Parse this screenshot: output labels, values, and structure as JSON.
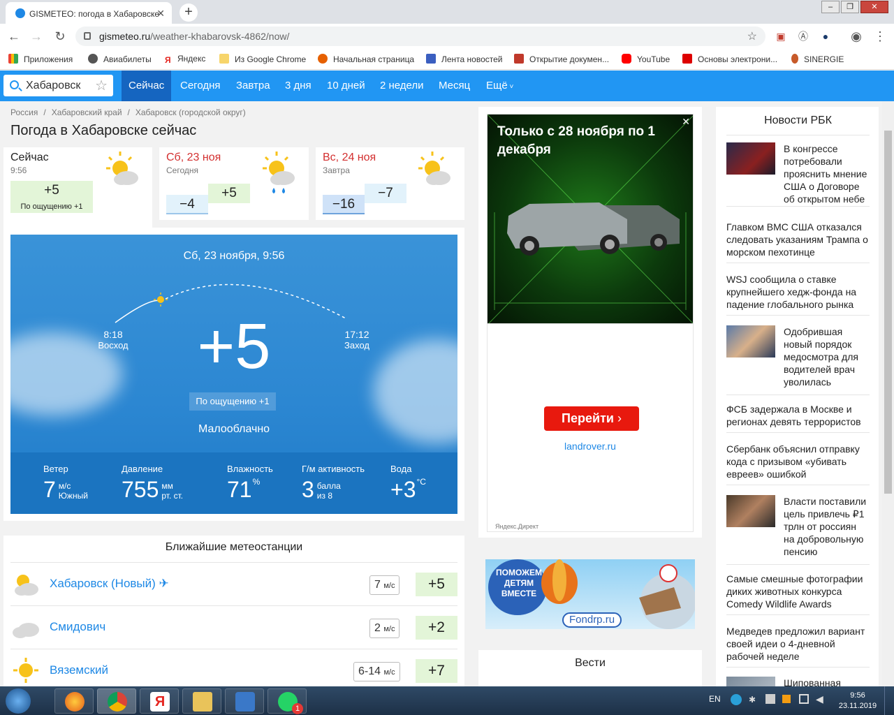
{
  "browser": {
    "tab_title": "GISMETEO: погода в Хабаровске",
    "address_host": "gismeteo.ru",
    "address_path": "/weather-khabarovsk-4862/now/",
    "bookmarks": [
      "Приложения",
      "Авиабилеты",
      "Яндекс",
      "Из Google Chrome",
      "Начальная страница",
      "Лента новостей",
      "Открытие докумен...",
      "YouTube",
      "Основы электрони...",
      "SINERGIE"
    ]
  },
  "site": {
    "search_value": "Хабаровск",
    "nav": [
      "Сейчас",
      "Сегодня",
      "Завтра",
      "3 дня",
      "10 дней",
      "2 недели",
      "Месяц",
      "Ещё"
    ],
    "breadcrumbs": [
      "Россия",
      "Хабаровский край",
      "Хабаровск (городской округ)"
    ],
    "page_title": "Погода в Хабаровске сейчас"
  },
  "cards": {
    "now": {
      "title": "Сейчас",
      "time": "9:56",
      "temp": "+5",
      "feels": "По ощущению +1"
    },
    "sat": {
      "title": "Сб, 23 ноя",
      "sub": "Сегодня",
      "min": "−4",
      "max": "+5"
    },
    "sun": {
      "title": "Вс, 24 ноя",
      "sub": "Завтра",
      "min": "−16",
      "max": "−7"
    }
  },
  "current": {
    "date": "Сб, 23 ноября, 9:56",
    "sunrise_time": "8:18",
    "sunrise_label": "Восход",
    "sunset_time": "17:12",
    "sunset_label": "Заход",
    "temp": "+5",
    "feels": "По ощущению +1",
    "condition": "Малооблачно",
    "stats": {
      "wind": {
        "label": "Ветер",
        "value": "7",
        "unit1": "м/с",
        "unit2": "Южный"
      },
      "pressure": {
        "label": "Давление",
        "value": "755",
        "unit1": "мм",
        "unit2": "рт. ст."
      },
      "humidity": {
        "label": "Влажность",
        "value": "71",
        "unit1": "%",
        "unit2": ""
      },
      "geomag": {
        "label": "Г/м активность",
        "value": "3",
        "unit1": "балла",
        "unit2": "из 8"
      },
      "water": {
        "label": "Вода",
        "value": "+3",
        "unit1": "°C",
        "unit2": ""
      }
    }
  },
  "stations": {
    "title": "Ближайшие метеостанции",
    "rows": [
      {
        "name": "Хабаровск (Новый) ✈",
        "wind": "7",
        "wind_unit": "м/с",
        "temp": "+5"
      },
      {
        "name": "Смидович",
        "wind": "2",
        "wind_unit": "м/с",
        "temp": "+2"
      },
      {
        "name": "Вяземский",
        "wind": "6-14",
        "wind_unit": "м/с",
        "temp": "+7"
      }
    ]
  },
  "ad": {
    "headline": "Только с 28 ноября по 1 декабря",
    "button": "Перейти",
    "domain": "landrover.ru",
    "footer": "Яндекс.Директ",
    "banner_text": "ПОМОЖЕМ ДЕТЯМ ВМЕСТЕ",
    "banner_site": "Fondrp.ru",
    "vesti": "Вести"
  },
  "news": {
    "title": "Новости РБК",
    "items": [
      "В конгрессе потребовали прояснить мнение США о Договоре об открытом небе",
      "Главком ВМС США отказался следовать указаниям Трампа о морском пехотинце",
      "WSJ сообщила о ставке крупнейшего хедж-фонда на падение глобального рынка",
      "Одобрившая новый порядок медосмотра для водителей врач уволилась",
      "ФСБ задержала в Москве и регионах девять террористов",
      "Сбербанк объяснил отправку кода с призывом «убивать евреев» ошибкой",
      "Власти поставили цель привлечь ₽1 трлн от россиян на добровольную пенсию",
      "Самые смешные фотографии диких животных конкурса Comedy Wildlife Awards",
      "Медведев предложил вариант своей идеи о 4-дневной рабочей неделе",
      "Шипованная"
    ]
  },
  "taskbar": {
    "lang": "EN",
    "time": "9:56",
    "date": "23.11.2019",
    "badge": "1"
  }
}
